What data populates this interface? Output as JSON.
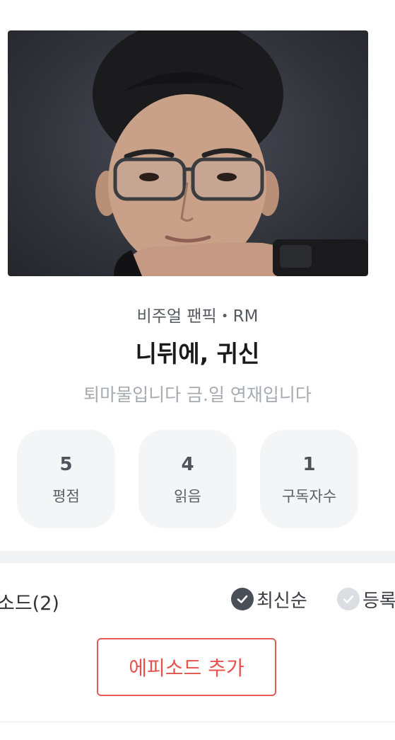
{
  "work": {
    "meta": "비주얼 팬픽・RM",
    "title": "니뒤에, 귀신",
    "description": "퇴마물입니다 금.일 연재입니다",
    "cover_alt": "cover-photo"
  },
  "stats": [
    {
      "value": "5",
      "label": "평점"
    },
    {
      "value": "4",
      "label": "읽음"
    },
    {
      "value": "1",
      "label": "구독자수"
    }
  ],
  "episodes": {
    "count_label": "소드(2)",
    "sort_latest": "최신순",
    "sort_registered": "등록",
    "add_button": "에피소드 추가"
  },
  "colors": {
    "accent": "#e6524d",
    "stat_bg": "#f4f5f7",
    "muted_text": "#a6abb1"
  }
}
